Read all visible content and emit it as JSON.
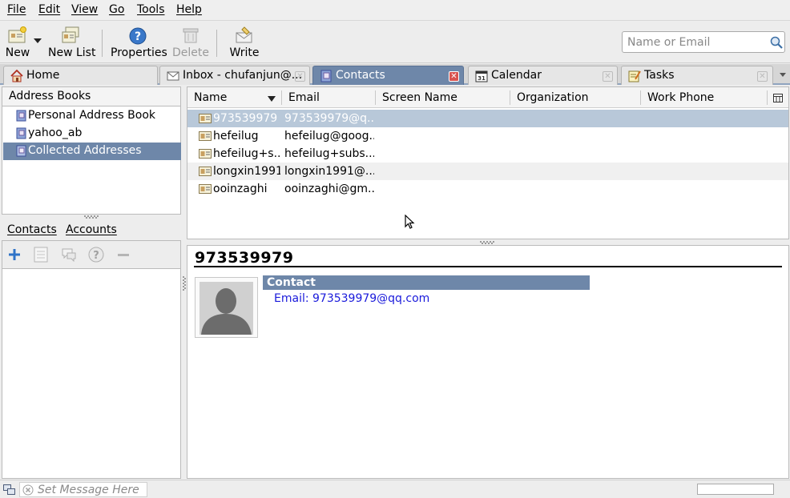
{
  "menubar": {
    "file": "File",
    "edit": "Edit",
    "view": "View",
    "go": "Go",
    "tools": "Tools",
    "help": "Help"
  },
  "toolbar": {
    "new": "New",
    "new_list": "New List",
    "properties": "Properties",
    "delete": "Delete",
    "write": "Write"
  },
  "search": {
    "placeholder": "Name or Email"
  },
  "tabs": [
    {
      "label": "Home"
    },
    {
      "label": "Inbox - chufanjun@..."
    },
    {
      "label": "Contacts"
    },
    {
      "label": "Calendar"
    },
    {
      "label": "Tasks"
    }
  ],
  "address_books": {
    "header": "Address Books",
    "items": [
      {
        "label": "Personal Address Book"
      },
      {
        "label": "yahoo_ab"
      },
      {
        "label": "Collected Addresses"
      }
    ]
  },
  "contacts_accounts_tabs": {
    "contacts": "Contacts",
    "accounts": "Accounts"
  },
  "results": {
    "columns": [
      "Name",
      "Email",
      "Screen Name",
      "Organization",
      "Work Phone"
    ],
    "rows": [
      {
        "name": "973539979",
        "email": "973539979@q..."
      },
      {
        "name": "hefeilug",
        "email": "hefeilug@goog..."
      },
      {
        "name": "hefeilug+s...",
        "email": "hefeilug+subs..."
      },
      {
        "name": "longxin1991",
        "email": "longxin1991@..."
      },
      {
        "name": "ooinzaghi",
        "email": "ooinzaghi@gm..."
      }
    ]
  },
  "contact_view": {
    "name": "973539979",
    "section_title": "Contact",
    "email_line": "Email: 973539979@qq.com"
  },
  "statusbar": {
    "message_placeholder": "Set Message Here"
  },
  "colors": {
    "accent": "#6e87a9",
    "selection_row": "#b8c8d9",
    "link": "#1a1adb"
  }
}
